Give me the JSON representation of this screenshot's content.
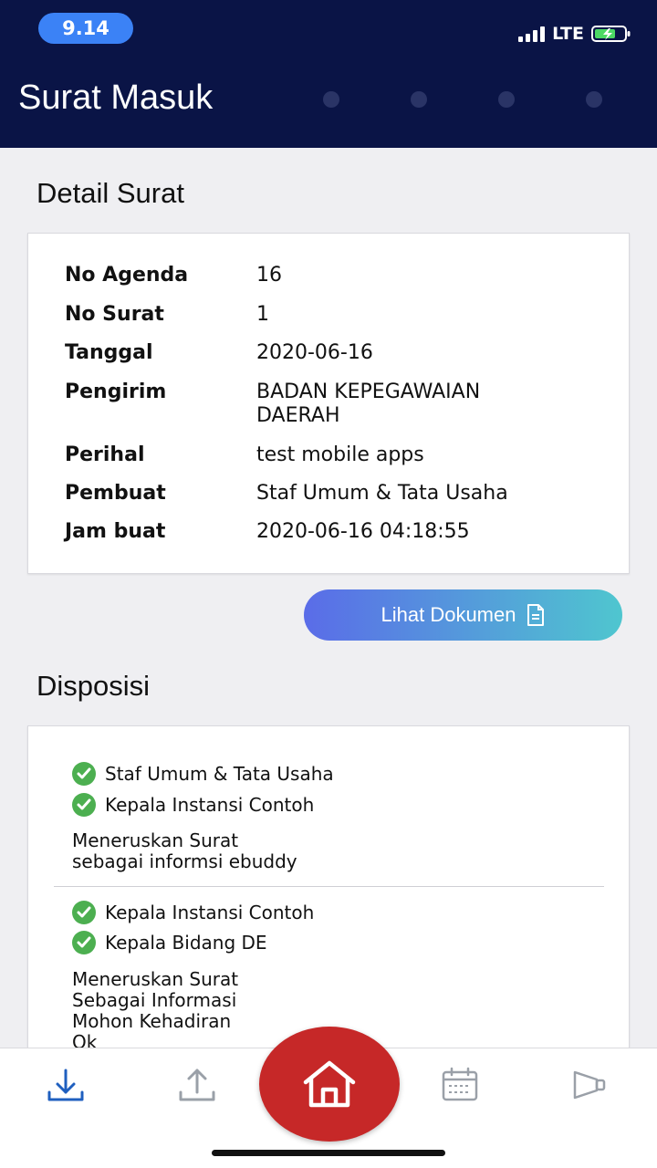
{
  "status_bar": {
    "time": "9.14",
    "network": "LTE"
  },
  "header": {
    "title": "Surat Masuk"
  },
  "detail": {
    "section_title": "Detail Surat",
    "rows": [
      {
        "label": "No Agenda",
        "value": "16"
      },
      {
        "label": "No Surat",
        "value": "1"
      },
      {
        "label": "Tanggal",
        "value": "2020-06-16"
      },
      {
        "label": "Pengirim",
        "value": "BADAN KEPEGAWAIAN DAERAH"
      },
      {
        "label": "Perihal",
        "value": "test mobile apps"
      },
      {
        "label": "Pembuat",
        "value": "Staf Umum & Tata Usaha"
      },
      {
        "label": "Jam buat",
        "value": "2020-06-16 04:18:55"
      }
    ],
    "button_label": "Lihat Dokumen"
  },
  "disposisi": {
    "section_title": "Disposisi",
    "entries": [
      {
        "from": "Staf Umum & Tata Usaha",
        "to": "Kepala Instansi Contoh",
        "note": "Meneruskan Surat\nsebagai informsi ebuddy"
      },
      {
        "from": "Kepala Instansi Contoh",
        "to": "Kepala Bidang DE",
        "note": "Meneruskan Surat\nSebagai Informasi\nMohon Kehadiran\nOk"
      }
    ]
  },
  "colors": {
    "header_bg": "#0a1446",
    "accent_blue": "#3b82f6",
    "check_green": "#4caf50",
    "home_red": "#c62828",
    "nav_active": "#1f5fbf",
    "nav_inactive": "#9aa0a8"
  },
  "nav": {
    "items": [
      "inbox-icon",
      "upload-icon",
      "home-icon",
      "calendar-icon",
      "megaphone-icon"
    ]
  }
}
